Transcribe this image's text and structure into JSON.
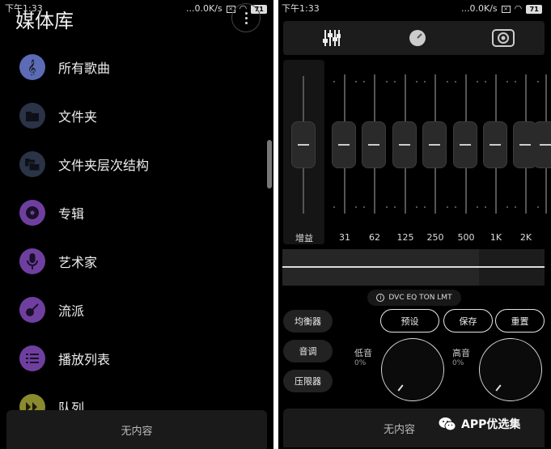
{
  "left": {
    "status": {
      "time": "下午1:33",
      "speed": "...0.0K/s",
      "battery": "71"
    },
    "title": "媒体库",
    "items": [
      {
        "label": "所有歌曲",
        "icon": "treble-clef-icon",
        "color": "#5b6bb5"
      },
      {
        "label": "文件夹",
        "icon": "folder-icon",
        "color": "#2b3346"
      },
      {
        "label": "文件夹层次结构",
        "icon": "folders-icon",
        "color": "#2b3346"
      },
      {
        "label": "专辑",
        "icon": "disc-icon",
        "color": "#6f3fa0"
      },
      {
        "label": "艺术家",
        "icon": "microphone-icon",
        "color": "#6f3fa0"
      },
      {
        "label": "流派",
        "icon": "guitar-icon",
        "color": "#6f3fa0"
      },
      {
        "label": "播放列表",
        "icon": "list-icon",
        "color": "#6f3fa0"
      },
      {
        "label": "队列",
        "icon": "queue-icon",
        "color": "#8a8a2e"
      }
    ],
    "bottom_text": "无内容"
  },
  "right": {
    "status": {
      "time": "下午1:33",
      "speed": "...0.0K/s",
      "battery": "71"
    },
    "tabs": [
      {
        "icon": "equalizer-sliders-icon"
      },
      {
        "icon": "knob-dial-icon"
      },
      {
        "icon": "speaker-icon"
      }
    ],
    "gain_label": "增益",
    "bands": [
      "31",
      "62",
      "125",
      "250",
      "500",
      "1K",
      "2K",
      ""
    ],
    "dsp_text": "DVC EQ TON LMT",
    "side_buttons": [
      "均衡器",
      "音调",
      "压限器"
    ],
    "preset_buttons": [
      "预设",
      "保存",
      "重置"
    ],
    "knobs": [
      {
        "label": "低音",
        "value": "0%"
      },
      {
        "label": "高音",
        "value": "0%"
      }
    ],
    "bottom_text": "无内容"
  },
  "watermark": "APP优选集"
}
